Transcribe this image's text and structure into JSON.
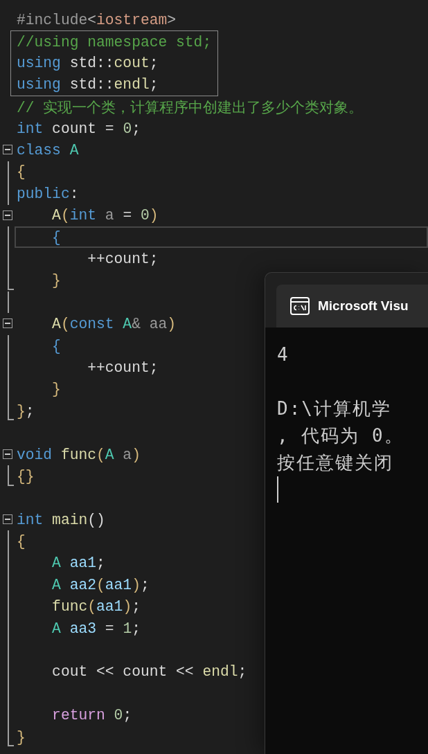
{
  "editor": {
    "lines": [
      {
        "tokens": [
          {
            "text": "#include",
            "kind": "preproc"
          },
          {
            "text": "<",
            "kind": "punct"
          },
          {
            "text": "iostream",
            "kind": "string"
          },
          {
            "text": ">",
            "kind": "punct"
          }
        ]
      },
      {
        "boxed": true,
        "tokens": [
          {
            "text": "//using namespace std;",
            "kind": "comment"
          }
        ]
      },
      {
        "boxed": true,
        "tokens": [
          {
            "text": "using",
            "kind": "keyword"
          },
          {
            "text": " std::",
            "kind": "plain"
          },
          {
            "text": "cout",
            "kind": "func"
          },
          {
            "text": ";",
            "kind": "plain"
          }
        ]
      },
      {
        "boxed": true,
        "tokens": [
          {
            "text": "using",
            "kind": "keyword"
          },
          {
            "text": " std::",
            "kind": "plain"
          },
          {
            "text": "endl",
            "kind": "func"
          },
          {
            "text": ";",
            "kind": "plain"
          }
        ]
      },
      {
        "tokens": [
          {
            "text": "// 实现一个类，计算程序中创建出了多少个类对象。",
            "kind": "comment"
          }
        ]
      },
      {
        "tokens": [
          {
            "text": "int",
            "kind": "keyword"
          },
          {
            "text": " count = ",
            "kind": "plain"
          },
          {
            "text": "0",
            "kind": "number"
          },
          {
            "text": ";",
            "kind": "plain"
          }
        ]
      },
      {
        "kind": "fold",
        "tokens": [
          {
            "text": "class",
            "kind": "keyword"
          },
          {
            "text": " A",
            "kind": "type"
          }
        ]
      },
      {
        "kind": "bar",
        "tokens": [
          {
            "text": "{",
            "kind": "brace"
          }
        ]
      },
      {
        "kind": "bar",
        "tokens": [
          {
            "text": "public",
            "kind": "keyword"
          },
          {
            "text": ":",
            "kind": "plain"
          }
        ]
      },
      {
        "kind": "fold",
        "tokens": [
          {
            "text": "    A",
            "kind": "func"
          },
          {
            "text": "(",
            "kind": "brace"
          },
          {
            "text": "int",
            "kind": "keyword"
          },
          {
            "text": " a ",
            "kind": "param"
          },
          {
            "text": "= ",
            "kind": "plain"
          },
          {
            "text": "0",
            "kind": "number"
          },
          {
            "text": ")",
            "kind": "brace"
          }
        ]
      },
      {
        "kind": "bar",
        "current": true,
        "tokens": [
          {
            "text": "    {",
            "kind": "brace2"
          }
        ]
      },
      {
        "kind": "bar",
        "tokens": [
          {
            "text": "        ++count;",
            "kind": "plain"
          }
        ]
      },
      {
        "kind": "end",
        "tokens": [
          {
            "text": "    }",
            "kind": "brace"
          }
        ]
      },
      {
        "kind": "bar"
      },
      {
        "kind": "fold",
        "tokens": [
          {
            "text": "    A",
            "kind": "func"
          },
          {
            "text": "(",
            "kind": "brace"
          },
          {
            "text": "const",
            "kind": "keyword"
          },
          {
            "text": " A",
            "kind": "type"
          },
          {
            "text": "& aa",
            "kind": "param"
          },
          {
            "text": ")",
            "kind": "brace"
          }
        ]
      },
      {
        "kind": "bar",
        "tokens": [
          {
            "text": "    {",
            "kind": "brace2"
          }
        ]
      },
      {
        "kind": "bar",
        "tokens": [
          {
            "text": "        ++count;",
            "kind": "plain"
          }
        ]
      },
      {
        "kind": "bar",
        "tokens": [
          {
            "text": "    }",
            "kind": "brace"
          }
        ]
      },
      {
        "kind": "end",
        "tokens": [
          {
            "text": "}",
            "kind": "brace"
          },
          {
            "text": ";",
            "kind": "plain"
          }
        ]
      },
      {
        "kind": "blank"
      },
      {
        "kind": "fold",
        "tokens": [
          {
            "text": "void",
            "kind": "keyword"
          },
          {
            "text": " func",
            "kind": "func"
          },
          {
            "text": "(",
            "kind": "brace"
          },
          {
            "text": "A",
            "kind": "type"
          },
          {
            "text": " a",
            "kind": "param"
          },
          {
            "text": ")",
            "kind": "brace"
          }
        ]
      },
      {
        "kind": "end",
        "tokens": [
          {
            "text": "{}",
            "kind": "brace"
          }
        ]
      },
      {
        "kind": "blank"
      },
      {
        "kind": "fold",
        "tokens": [
          {
            "text": "int",
            "kind": "keyword"
          },
          {
            "text": " main",
            "kind": "func"
          },
          {
            "text": "()",
            "kind": "plain"
          }
        ]
      },
      {
        "kind": "bar",
        "tokens": [
          {
            "text": "{",
            "kind": "brace"
          }
        ]
      },
      {
        "kind": "bar",
        "tokens": [
          {
            "text": "    A",
            "kind": "type"
          },
          {
            "text": " aa1",
            "kind": "var"
          },
          {
            "text": ";",
            "kind": "plain"
          }
        ]
      },
      {
        "kind": "bar",
        "tokens": [
          {
            "text": "    A",
            "kind": "type"
          },
          {
            "text": " aa2",
            "kind": "var"
          },
          {
            "text": "(",
            "kind": "brace"
          },
          {
            "text": "aa1",
            "kind": "var"
          },
          {
            "text": ")",
            "kind": "brace"
          },
          {
            "text": ";",
            "kind": "plain"
          }
        ]
      },
      {
        "kind": "bar",
        "tokens": [
          {
            "text": "    func",
            "kind": "func"
          },
          {
            "text": "(",
            "kind": "brace"
          },
          {
            "text": "aa1",
            "kind": "var"
          },
          {
            "text": ")",
            "kind": "brace"
          },
          {
            "text": ";",
            "kind": "plain"
          }
        ]
      },
      {
        "kind": "bar",
        "tokens": [
          {
            "text": "    A",
            "kind": "type"
          },
          {
            "text": " aa3",
            "kind": "var"
          },
          {
            "text": " = ",
            "kind": "plain"
          },
          {
            "text": "1",
            "kind": "number"
          },
          {
            "text": ";",
            "kind": "plain"
          }
        ]
      },
      {
        "kind": "bar"
      },
      {
        "kind": "bar",
        "tokens": [
          {
            "text": "    cout << count << ",
            "kind": "plain"
          },
          {
            "text": "endl",
            "kind": "func"
          },
          {
            "text": ";",
            "kind": "plain"
          }
        ]
      },
      {
        "kind": "bar"
      },
      {
        "kind": "bar",
        "tokens": [
          {
            "text": "    return",
            "kind": "control"
          },
          {
            "text": " 0",
            "kind": "number"
          },
          {
            "text": ";",
            "kind": "plain"
          }
        ]
      },
      {
        "kind": "end",
        "tokens": [
          {
            "text": "}",
            "kind": "brace"
          }
        ]
      }
    ]
  },
  "console": {
    "title": "Microsoft Visu",
    "output": "4",
    "messages": [
      "D:\\计算机学",
      ", 代码为 0。",
      "按任意键关闭"
    ],
    "cursor": true
  }
}
